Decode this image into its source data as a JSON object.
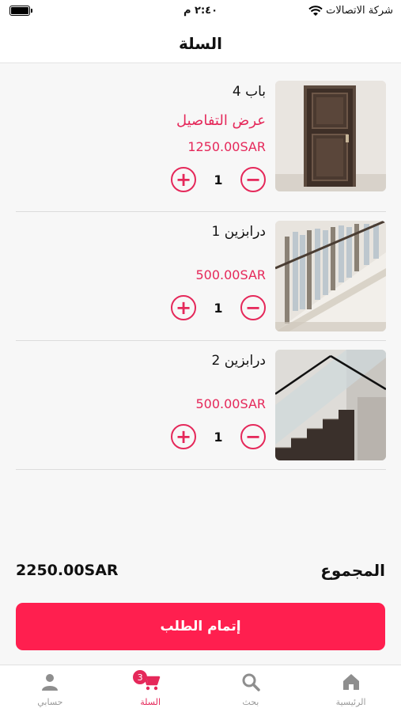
{
  "status_bar": {
    "carrier": "شركة الاتصالات",
    "time": "٢:٤٠ م"
  },
  "header": {
    "title": "السلة"
  },
  "cart": {
    "items": [
      {
        "name": "باب 4",
        "details_link": "عرض التفاصيل",
        "price": "1250.00SAR",
        "quantity": "1",
        "image_icon": "door-image"
      },
      {
        "name": "درابزين 1",
        "details_link": "",
        "price": "500.00SAR",
        "quantity": "1",
        "image_icon": "crystal-railing-image"
      },
      {
        "name": "درابزين 2",
        "details_link": "",
        "price": "500.00SAR",
        "quantity": "1",
        "image_icon": "glass-railing-image"
      }
    ],
    "increase_symbol": "+",
    "decrease_symbol": "−"
  },
  "summary": {
    "total_label": "المجموع",
    "total_value": "2250.00SAR"
  },
  "checkout": {
    "label": "إتمام الطلب"
  },
  "bottom_nav": {
    "items": [
      {
        "label": "الرئيسية",
        "icon": "home-icon"
      },
      {
        "label": "بحث",
        "icon": "search-icon"
      },
      {
        "label": "السلة",
        "icon": "cart-icon",
        "badge": "3"
      },
      {
        "label": "حسابي",
        "icon": "user-icon"
      }
    ]
  },
  "colors": {
    "accent": "#e5285a",
    "checkout_button": "#ff1f4f",
    "inactive": "#999999"
  }
}
